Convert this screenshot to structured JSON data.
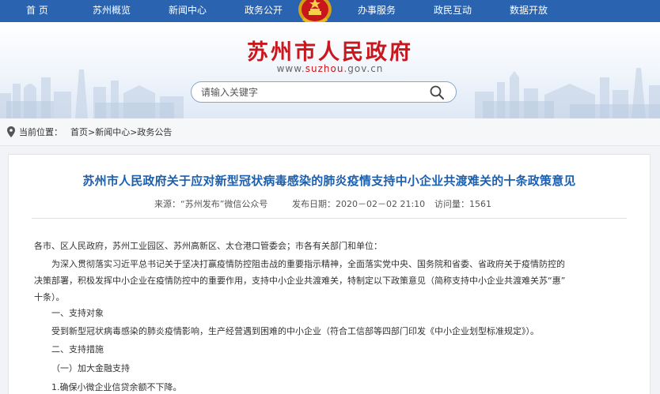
{
  "nav": {
    "items": [
      "首  页",
      "苏州概览",
      "新闻中心",
      "政务公开",
      "办事服务",
      "政民互动",
      "数据开放"
    ]
  },
  "header": {
    "site_title": "苏州市人民政府",
    "url_prefix": "www.",
    "url_highlight": "suzhou",
    "url_suffix": ".gov.cn"
  },
  "search": {
    "placeholder": "请输入关键字",
    "icon": "search-icon"
  },
  "breadcrumb": {
    "label": "当前位置：",
    "path": "首页>新闻中心>政务公告"
  },
  "article": {
    "title": "苏州市人民政府关于应对新型冠状病毒感染的肺炎疫情支持中小企业共渡难关的十条政策意见",
    "source": "来源：“苏州发布”微信公众号",
    "date": "发布日期：2020－02－02 21:10",
    "views": "访问量：1561",
    "body": {
      "salutation": "各市、区人民政府，苏州工业园区、苏州高新区、太仓港口管委会；市各有关部门和单位：",
      "intro_line1": "为深入贯彻落实习近平总书记关于坚决打赢疫情防控阻击战的重要指示精神，全面落实党中央、国务院和省委、省政府关于疫情防控的",
      "intro_line2": "决策部署，积极发挥中小企业在疫情防控中的重要作用，支持中小企业共渡难关，特制定以下政策意见（简称支持中小企业共渡难关苏“惠”",
      "intro_line3": "十条）。",
      "section1": "一、支持对象",
      "section1_text": "受到新型冠状病毒感染的肺炎疫情影响，生产经营遇到困难的中小企业（符合工信部等四部门印发《中小企业划型标准规定》）。",
      "section2": "二、支持措施",
      "sub1": "（一）加大金融支持",
      "item1": "1.确保小微企业信贷余额不下降。"
    }
  },
  "colors": {
    "nav_bg": "#2a63b0",
    "title_red": "#c9171e",
    "article_title_blue": "#1b5fae"
  }
}
